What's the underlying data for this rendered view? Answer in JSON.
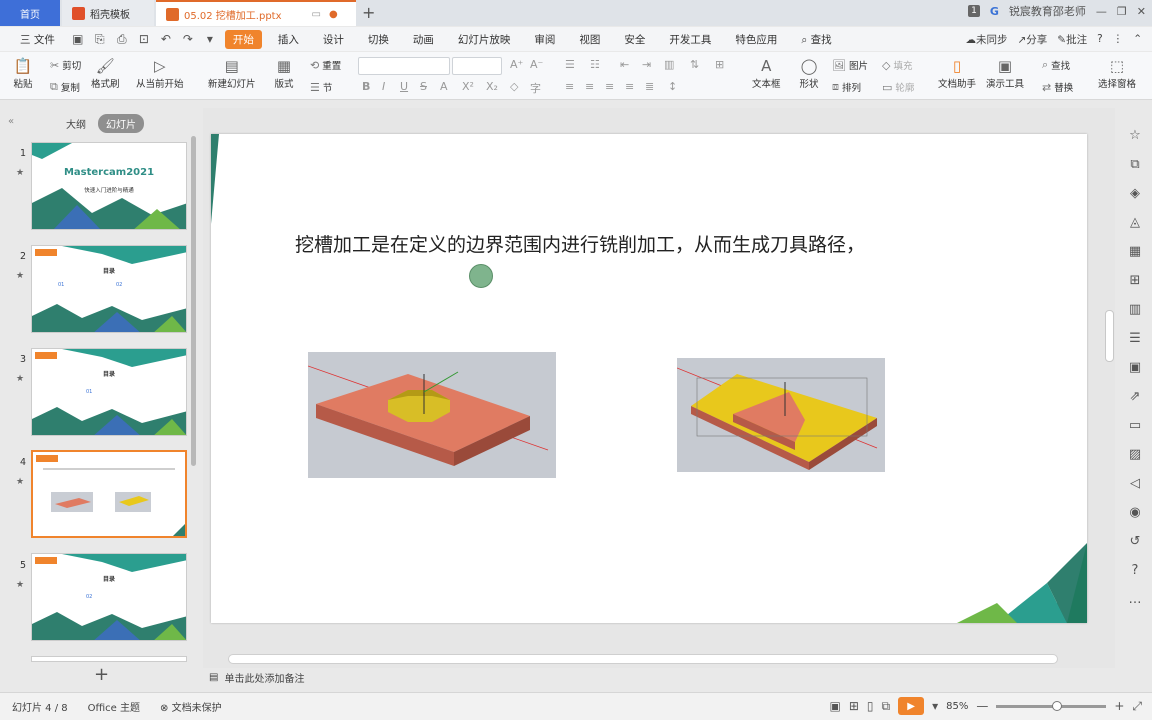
{
  "tabs": {
    "home": "首页",
    "template": "稻壳模板",
    "document": "05.02 挖槽加工.pptx",
    "new_tab": "+"
  },
  "titlebar": {
    "page_badge": "1",
    "user": "锐宸教育邵老师",
    "colors": {
      "home_tab": "#3e6fd8",
      "doc_tab": "#e06a2a"
    }
  },
  "menu": {
    "file": "三 文件",
    "items": [
      "开始",
      "插入",
      "设计",
      "切换",
      "动画",
      "幻灯片放映",
      "审阅",
      "视图",
      "安全",
      "开发工具",
      "特色应用"
    ],
    "active": "开始",
    "search": "查找",
    "right": {
      "sync": "未同步",
      "share": "分享",
      "comment": "批注"
    }
  },
  "ribbon": {
    "paste": "粘贴",
    "cut": "剪切",
    "copy": "复制",
    "format_painter": "格式刷",
    "from_current": "从当前开始",
    "new_slide": "新建幻灯片",
    "layout": "版式",
    "reset": "重置",
    "section": "节",
    "textbox": "文本框",
    "shape": "形状",
    "picture": "图片",
    "arrange": "排列",
    "fill": "填充",
    "outline": "轮廓",
    "doc_helper": "文档助手",
    "present_tool": "演示工具",
    "find": "查找",
    "replace": "替换",
    "select_pane": "选择窗格"
  },
  "panel": {
    "outline": "大纲",
    "slides": "幻灯片",
    "thumbs": [
      {
        "num": "1",
        "title": "Mastercam2021",
        "subtitle": "快速入门进阶与精通"
      },
      {
        "num": "2",
        "title": "目录",
        "items": [
          "01",
          "02"
        ]
      },
      {
        "num": "3",
        "title": "目录",
        "items": [
          "01"
        ]
      },
      {
        "num": "4",
        "title": "",
        "items": []
      },
      {
        "num": "5",
        "title": "目录",
        "items": [
          "02"
        ]
      }
    ],
    "active_slide": 4
  },
  "slide": {
    "text": "挖槽加工是在定义的边界范围内进行铣削加工，从而生成刀具路径，"
  },
  "notes": {
    "placeholder": "单击此处添加备注"
  },
  "status": {
    "slide_count": "幻灯片 4 / 8",
    "theme": "Office 主题",
    "protect": "文档未保护",
    "zoom": "85%"
  }
}
